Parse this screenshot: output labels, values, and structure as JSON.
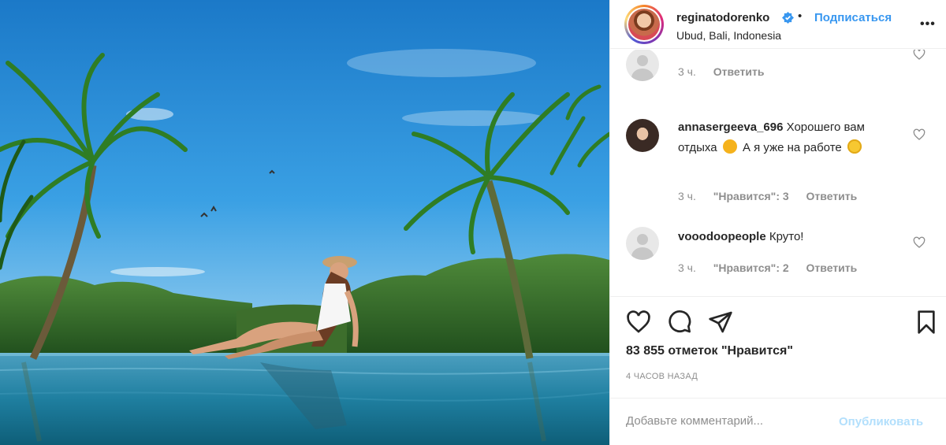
{
  "post": {
    "username": "reginatodorenko",
    "follow_label": "Подписаться",
    "separator": "•",
    "location": "Ubud, Bali, Indonesia",
    "more_label": "•••"
  },
  "comments": [
    {
      "username": "",
      "text": "",
      "time": "3 ч.",
      "likes": "",
      "reply": "Ответить"
    },
    {
      "username": "annasergeeva_696",
      "text_1": "Хорошего вам отдыха",
      "text_2": "А я уже на работе",
      "time": "3 ч.",
      "likes": "\"Нравится\": 3",
      "reply": "Ответить"
    },
    {
      "username": "vooodoopeople",
      "text": "Круто!",
      "time": "3 ч.",
      "likes": "\"Нравится\": 2",
      "reply": "Ответить"
    }
  ],
  "actions": {
    "like_icon": "heart-icon",
    "comment_icon": "comment-bubble-icon",
    "share_icon": "paper-plane-icon",
    "save_icon": "bookmark-icon"
  },
  "likes_text": "83 855 отметок \"Нравится\"",
  "time_ago": "4 ЧАСОВ НАЗАД",
  "add_comment": {
    "placeholder": "Добавьте комментарий...",
    "publish_label": "Опубликовать"
  },
  "colors": {
    "link": "#3897f0",
    "publish_disabled": "#b2dffc",
    "muted": "#8e8e8e"
  }
}
